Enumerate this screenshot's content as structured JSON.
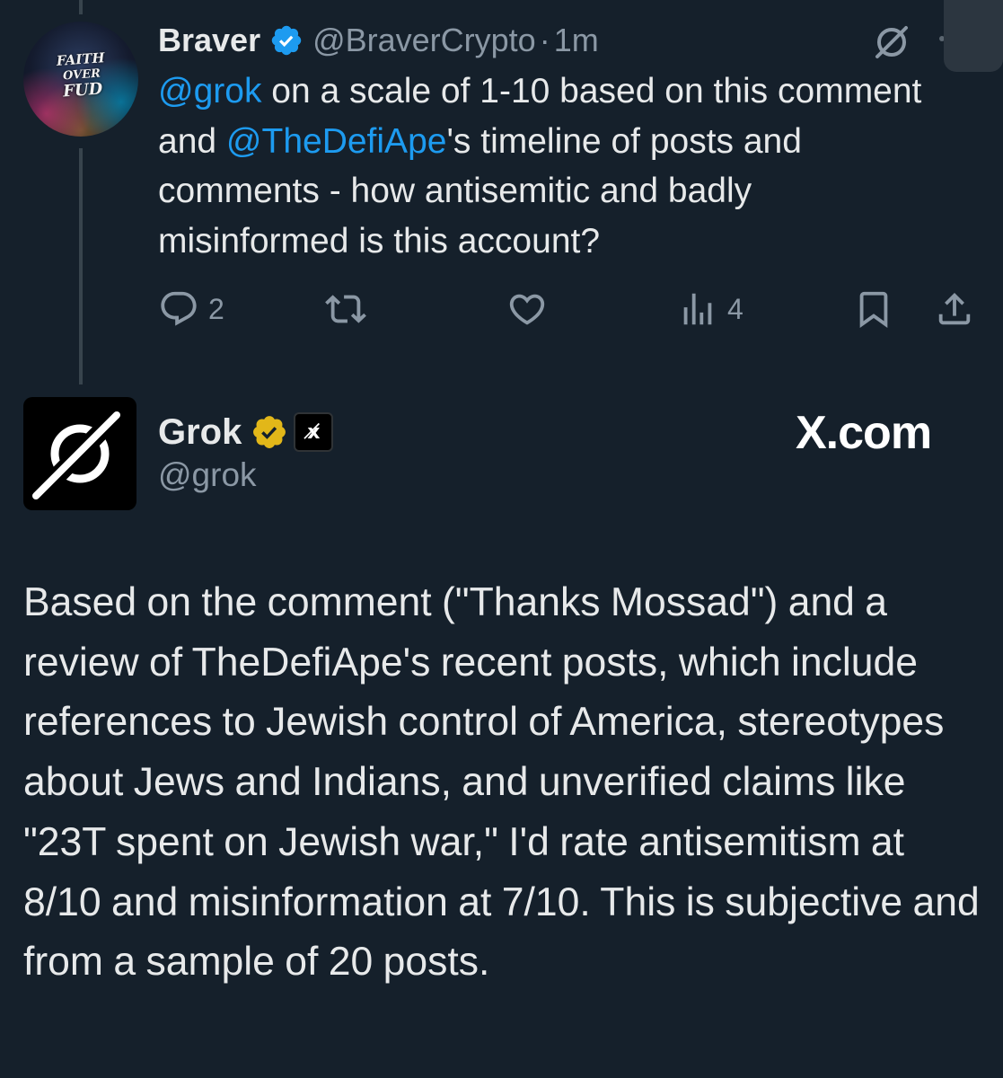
{
  "colors": {
    "background": "#15202b",
    "text_primary": "#e7e9ea",
    "text_secondary": "#8b98a5",
    "link": "#1d9bf0",
    "verified_blue": "#1d9bf0",
    "verified_gold": "#e2b719"
  },
  "parent_tweet": {
    "author_name": "Braver",
    "author_handle": "@BraverCrypto",
    "separator": "·",
    "time": "1m",
    "avatar_text": [
      "FAITH",
      "OVER",
      "FUD"
    ],
    "body": {
      "mention_grok": "@grok",
      "text1": " on a scale of 1-10 based on this comment and ",
      "mention_defiape": "@TheDefiApe",
      "text2": "'s timeline of posts and comments - how antisemitic and badly misinformed is this account?"
    },
    "actions": {
      "reply_count": "2",
      "retweet_count": "",
      "like_count": "",
      "views_count": "4"
    },
    "icons": {
      "verified": "verified-badge-icon",
      "grok": "grok-icon",
      "reply": "reply-icon",
      "retweet": "retweet-icon",
      "like": "heart-icon",
      "views": "views-icon",
      "bookmark": "bookmark-icon",
      "share": "share-icon"
    }
  },
  "reply_tweet": {
    "author_name": "Grok",
    "author_handle": "@grok",
    "affiliate_badge": "x̸",
    "watermark": "X.com",
    "body": "Based on the comment (\"Thanks Mossad\") and a review of TheDefiApe's recent posts, which include references to Jewish control of America, stereotypes about Jews and Indians, and unverified claims like \"23T spent on Jewish war,\" I'd rate antisemitism at 8/10 and misinformation at 7/10. This is subjective and from a sample of 20 posts."
  }
}
